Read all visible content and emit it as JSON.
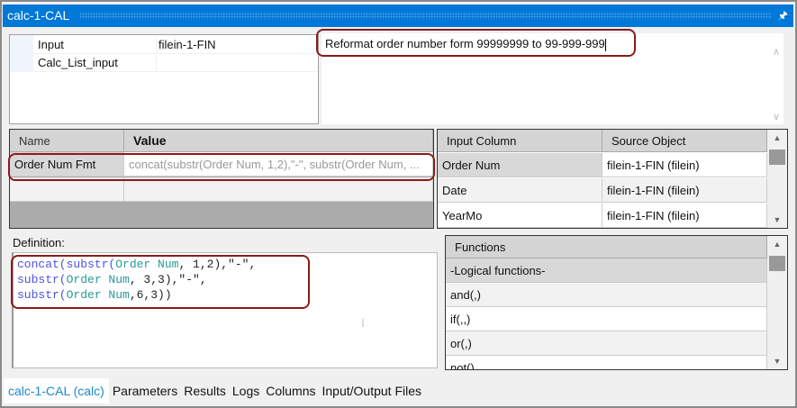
{
  "window": {
    "title": "calc-1-CAL",
    "pin_icon": "pin-icon"
  },
  "properties": [
    {
      "key": "Input",
      "value": "filein-1-FIN"
    },
    {
      "key": "Calc_List_input",
      "value": ""
    }
  ],
  "description": "Reformat order number form 99999999 to 99-999-999",
  "calc_grid": {
    "headers": [
      "Name",
      "Value"
    ],
    "rows": [
      {
        "name": "Order Num Fmt",
        "value": "concat(substr(Order Num, 1,2),\"-\", substr(Order Num, ..."
      }
    ]
  },
  "input_grid": {
    "headers": [
      "Input Column",
      "Source Object"
    ],
    "rows": [
      {
        "col": "Order Num",
        "src": "filein-1-FIN (filein)"
      },
      {
        "col": "Date",
        "src": "filein-1-FIN (filein)"
      },
      {
        "col": "YearMo",
        "src": "filein-1-FIN (filein)"
      }
    ]
  },
  "definition": {
    "label": "Definition:",
    "lines": [
      [
        {
          "t": "concat(",
          "c": "fn"
        },
        {
          "t": "substr(",
          "c": "fn"
        },
        {
          "t": "Order Num",
          "c": "id"
        },
        {
          "t": ", 1,2),\"-\",",
          "c": "str"
        }
      ],
      [
        {
          "t": "substr(",
          "c": "fn"
        },
        {
          "t": "Order Num",
          "c": "id"
        },
        {
          "t": ", 3,3),\"-\",",
          "c": "str"
        }
      ],
      [
        {
          "t": "substr(",
          "c": "fn"
        },
        {
          "t": "Order Num",
          "c": "id"
        },
        {
          "t": ",6,3))",
          "c": "str"
        }
      ]
    ]
  },
  "functions": {
    "header": "Functions",
    "items": [
      "-Logical functions-",
      "and(,)",
      "if(,,)",
      "or(,)",
      "not()"
    ]
  },
  "tabs": [
    "calc-1-CAL (calc)",
    "Parameters",
    "Results",
    "Logs",
    "Columns",
    "Input/Output Files"
  ]
}
